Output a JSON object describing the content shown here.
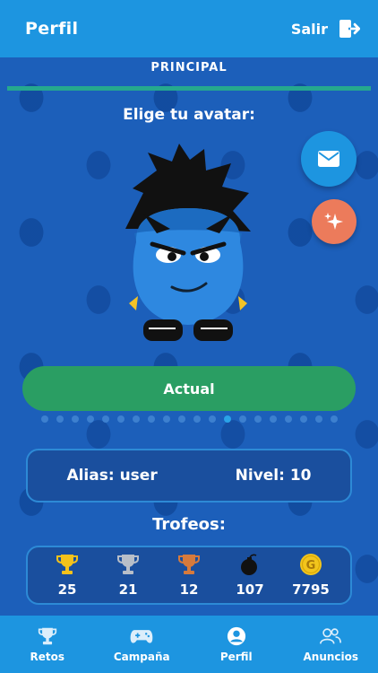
{
  "header": {
    "title": "Perfil",
    "logout_label": "Salir"
  },
  "tabs": {
    "active": "PRINCIPAL"
  },
  "avatar": {
    "prompt": "Elige tu avatar:",
    "select_label": "Actual",
    "total_slides": 20,
    "active_slide": 12
  },
  "profile": {
    "alias": "Alias: user",
    "level": "Nivel: 10"
  },
  "trophies": {
    "title": "Trofeos:",
    "items": [
      {
        "icon": "gold-trophy-icon",
        "count": "25",
        "color": "#f4c21b"
      },
      {
        "icon": "silver-trophy-icon",
        "count": "21",
        "color": "#b7bec8"
      },
      {
        "icon": "bronze-trophy-icon",
        "count": "12",
        "color": "#d67a3c"
      },
      {
        "icon": "bomb-icon",
        "count": "107",
        "color": "#111111"
      },
      {
        "icon": "coin-icon",
        "count": "7795",
        "color": "#f2c51c"
      }
    ]
  },
  "nav": {
    "items": [
      {
        "label": "Retos",
        "icon": "trophy-icon"
      },
      {
        "label": "Campaña",
        "icon": "gamepad-icon"
      },
      {
        "label": "Perfil",
        "icon": "user-icon"
      },
      {
        "label": "Anuncios",
        "icon": "users-icon"
      }
    ]
  },
  "colors": {
    "header": "#1d95e0",
    "background": "#1b5db8",
    "accent_green": "#2a9e63",
    "fab_orange": "#ec7b5b"
  }
}
